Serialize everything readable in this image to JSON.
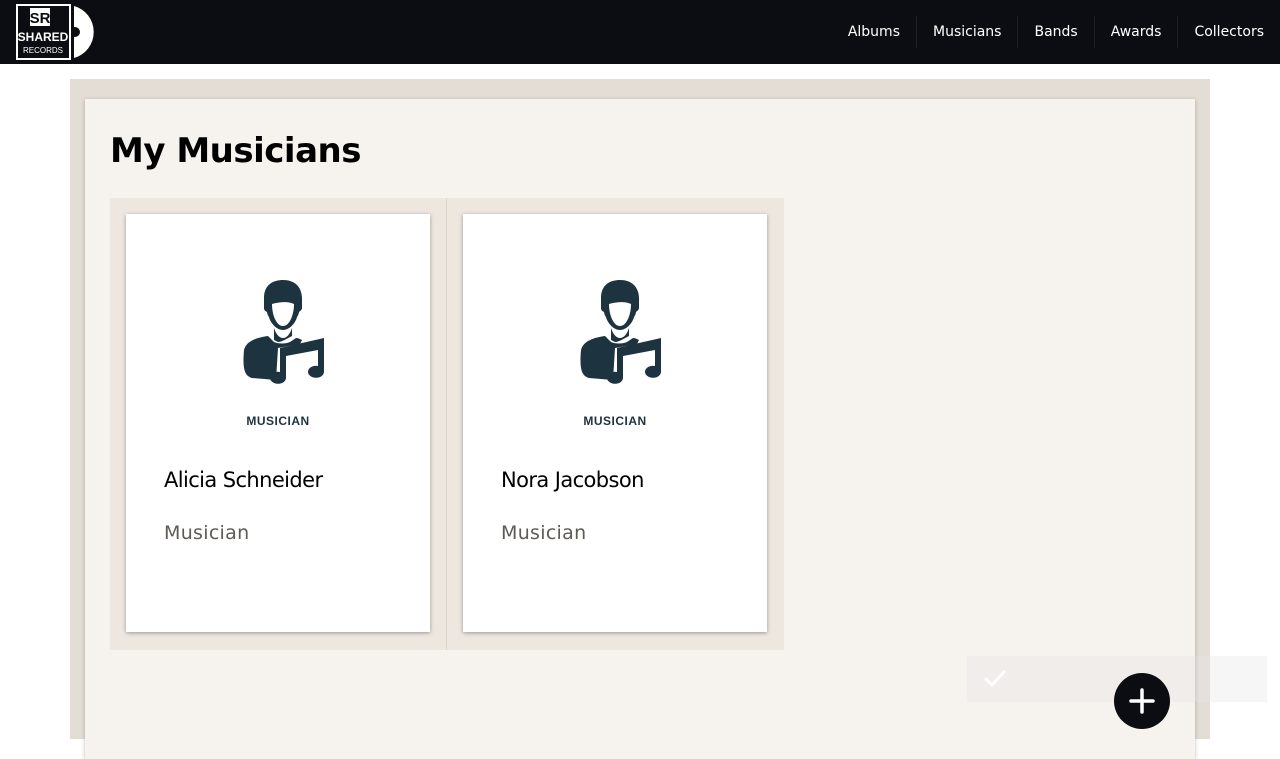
{
  "brand": {
    "logo_top": "SR",
    "logo_mid": "SHARED",
    "logo_bottom": "RECORDS"
  },
  "nav": {
    "items": [
      {
        "label": "Albums"
      },
      {
        "label": "Musicians"
      },
      {
        "label": "Bands"
      },
      {
        "label": "Awards"
      },
      {
        "label": "Collectors"
      }
    ]
  },
  "page": {
    "title": "My Musicians"
  },
  "cards": [
    {
      "icon": "musician-icon",
      "tag": "MUSICIAN",
      "name": "Alicia Schneider",
      "role": "Musician"
    },
    {
      "icon": "musician-icon",
      "tag": "MUSICIAN",
      "name": "Nora Jacobson",
      "role": "Musician"
    }
  ],
  "toast": {
    "icon": "check-icon"
  },
  "fab": {
    "icon": "plus-icon"
  },
  "colors": {
    "navbar": "#0b0d12",
    "panel": "#f6f2ed",
    "outer": "#e3ddd6",
    "icon": "#1e3340",
    "role_text": "#5e5a55"
  }
}
